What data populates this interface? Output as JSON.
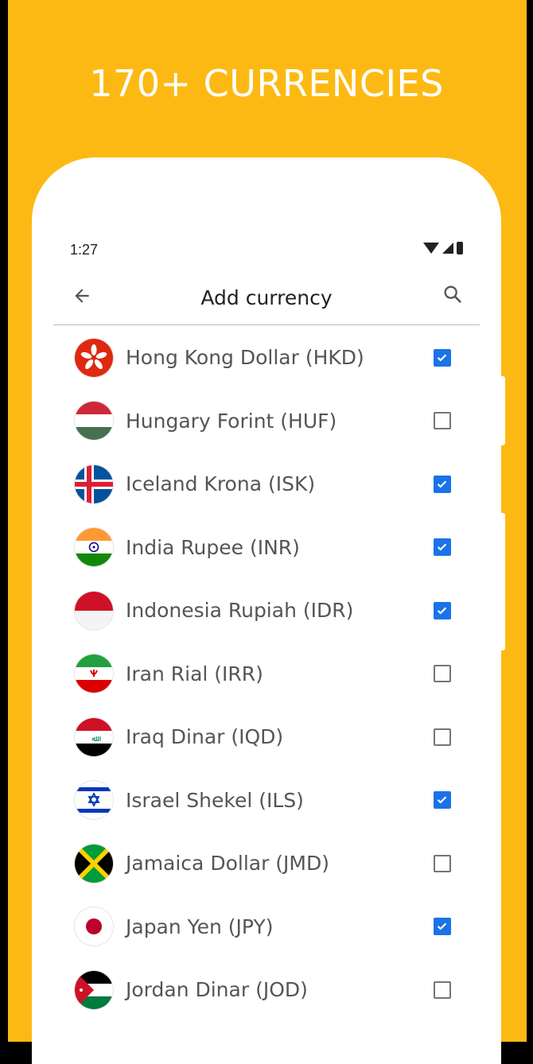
{
  "promo": {
    "title": "170+ CURRENCIES"
  },
  "status_bar": {
    "time": "1:27"
  },
  "appbar": {
    "title": "Add currency"
  },
  "currencies": [
    {
      "name": "Hong Kong Dollar (HKD)",
      "checked": true,
      "flag": "hk-flag-icon"
    },
    {
      "name": "Hungary Forint (HUF)",
      "checked": false,
      "flag": "hu-flag-icon"
    },
    {
      "name": "Iceland Krona (ISK)",
      "checked": true,
      "flag": "is-flag-icon"
    },
    {
      "name": "India Rupee (INR)",
      "checked": true,
      "flag": "in-flag-icon"
    },
    {
      "name": "Indonesia Rupiah (IDR)",
      "checked": true,
      "flag": "id-flag-icon"
    },
    {
      "name": "Iran Rial (IRR)",
      "checked": false,
      "flag": "ir-flag-icon"
    },
    {
      "name": "Iraq Dinar (IQD)",
      "checked": false,
      "flag": "iq-flag-icon"
    },
    {
      "name": "Israel Shekel (ILS)",
      "checked": true,
      "flag": "il-flag-icon"
    },
    {
      "name": "Jamaica Dollar (JMD)",
      "checked": false,
      "flag": "jm-flag-icon"
    },
    {
      "name": "Japan Yen (JPY)",
      "checked": true,
      "flag": "jp-flag-icon"
    },
    {
      "name": "Jordan Dinar (JOD)",
      "checked": false,
      "flag": "jo-flag-icon"
    }
  ],
  "colors": {
    "accent": "#1A73E8",
    "background": "#FDB913"
  }
}
